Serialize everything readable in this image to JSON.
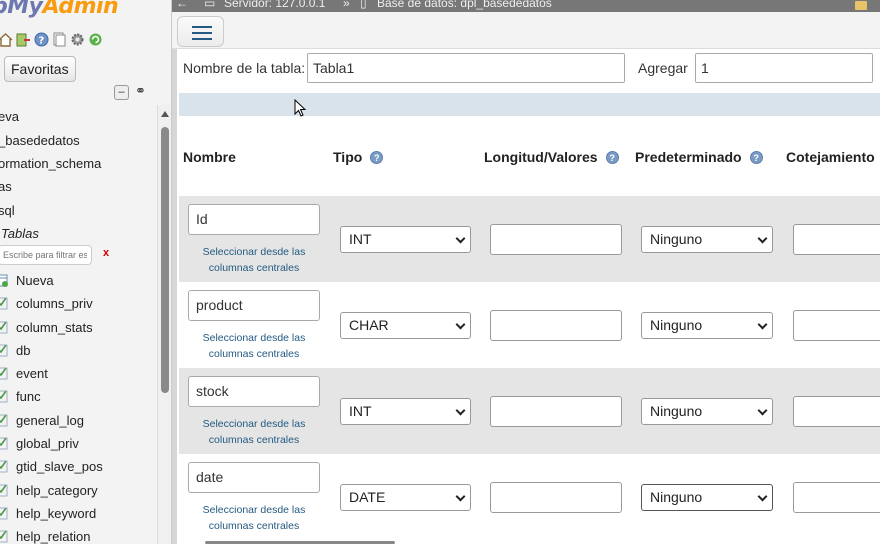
{
  "app": {
    "logo_part1": "pMy",
    "logo_part2": "Admin"
  },
  "breadcrumb": {
    "server": "Servidor: 127.0.0.1",
    "sep": "»",
    "database": "Base de datos: dpl_basededatos"
  },
  "sidebar": {
    "favorites_label": "Favoritas",
    "databases": [
      "eva",
      "_basededatos",
      "ormation_schema",
      "as",
      "sql"
    ],
    "tables_label": "Tablas",
    "filter_placeholder": "Escribe para filtrar es",
    "filter_clear": "x",
    "tables": [
      "Nueva",
      "columns_priv",
      "column_stats",
      "db",
      "event",
      "func",
      "general_log",
      "global_priv",
      "gtid_slave_pos",
      "help_category",
      "help_keyword",
      "help_relation"
    ]
  },
  "form": {
    "table_name_label": "Nombre de la tabla:",
    "table_name_value": "Tabla1",
    "add_label": "Agregar",
    "add_value": "1"
  },
  "columns_header": {
    "name": "Nombre",
    "type": "Tipo",
    "length": "Longitud/Valores",
    "default": "Predeterminado",
    "collation": "Cotejamiento"
  },
  "rows": [
    {
      "name": "Id",
      "type": "INT",
      "length": "",
      "default": "Ninguno",
      "central_link": "Seleccionar desde las columnas centrales"
    },
    {
      "name": "product",
      "type": "CHAR",
      "length": "",
      "default": "Ninguno",
      "central_link": "Seleccionar desde las columnas centrales"
    },
    {
      "name": "stock",
      "type": "INT",
      "length": "",
      "default": "Ninguno",
      "central_link": "Seleccionar desde las columnas centrales"
    },
    {
      "name": "date",
      "type": "DATE",
      "length": "",
      "default": "Ninguno",
      "central_link": "Seleccionar desde las columnas centrales"
    }
  ],
  "icons": [
    "home-icon",
    "exit-icon",
    "help-icon",
    "docs-icon",
    "settings-icon",
    "reload-icon",
    "collapse-icon",
    "link-icon",
    "table-icon",
    "menu-icon",
    "server-icon",
    "database-icon"
  ]
}
